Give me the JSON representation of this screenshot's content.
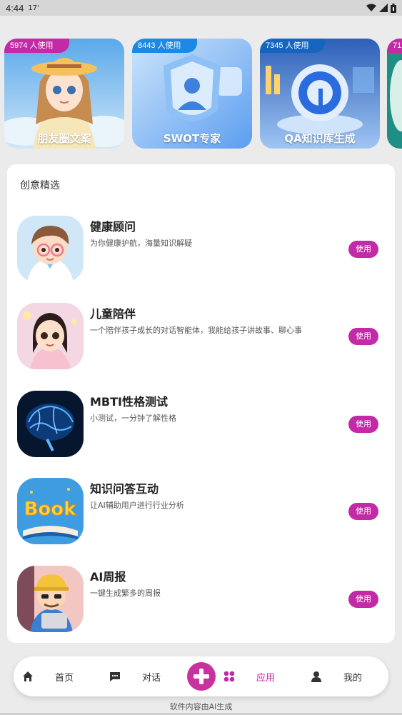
{
  "status_bar": {
    "time": "4:44",
    "extra": "17'",
    "icons": [
      "wifi-icon",
      "signal-icon",
      "battery-icon"
    ]
  },
  "carousel": [
    {
      "badge": "5974 人使用",
      "title": "朋友圈文案",
      "badge_color": "#c22aa6"
    },
    {
      "badge": "8443 人使用",
      "title": "SWOT专家",
      "badge_color": "#1e88e5"
    },
    {
      "badge": "7345 人使用",
      "title": "QA知识库生成",
      "badge_color": "#1565c0"
    },
    {
      "badge": "71",
      "title": "",
      "badge_color": "#c22aa6"
    }
  ],
  "section": {
    "title": "创意精选",
    "items": [
      {
        "name": "健康顾问",
        "desc": "为你健康护航，海量知识解疑",
        "button": "使用"
      },
      {
        "name": "儿童陪伴",
        "desc": "一个陪伴孩子成长的对话智能体，我能给孩子讲故事、聊心事",
        "button": "使用"
      },
      {
        "name": "MBTI性格测试",
        "desc": "小测试，一分钟了解性格",
        "button": "使用"
      },
      {
        "name": "知识问答互动",
        "desc": "让AI辅助用户进行行业分析",
        "button": "使用"
      },
      {
        "name": "AI周报",
        "desc": "一键生成繁多的周报",
        "button": "使用"
      }
    ]
  },
  "nav": {
    "home": "首页",
    "chat": "对话",
    "apps": "应用",
    "mine": "我的",
    "active": "apps",
    "accent": "#c22aa6"
  },
  "footer": "软件内容由AI生成"
}
